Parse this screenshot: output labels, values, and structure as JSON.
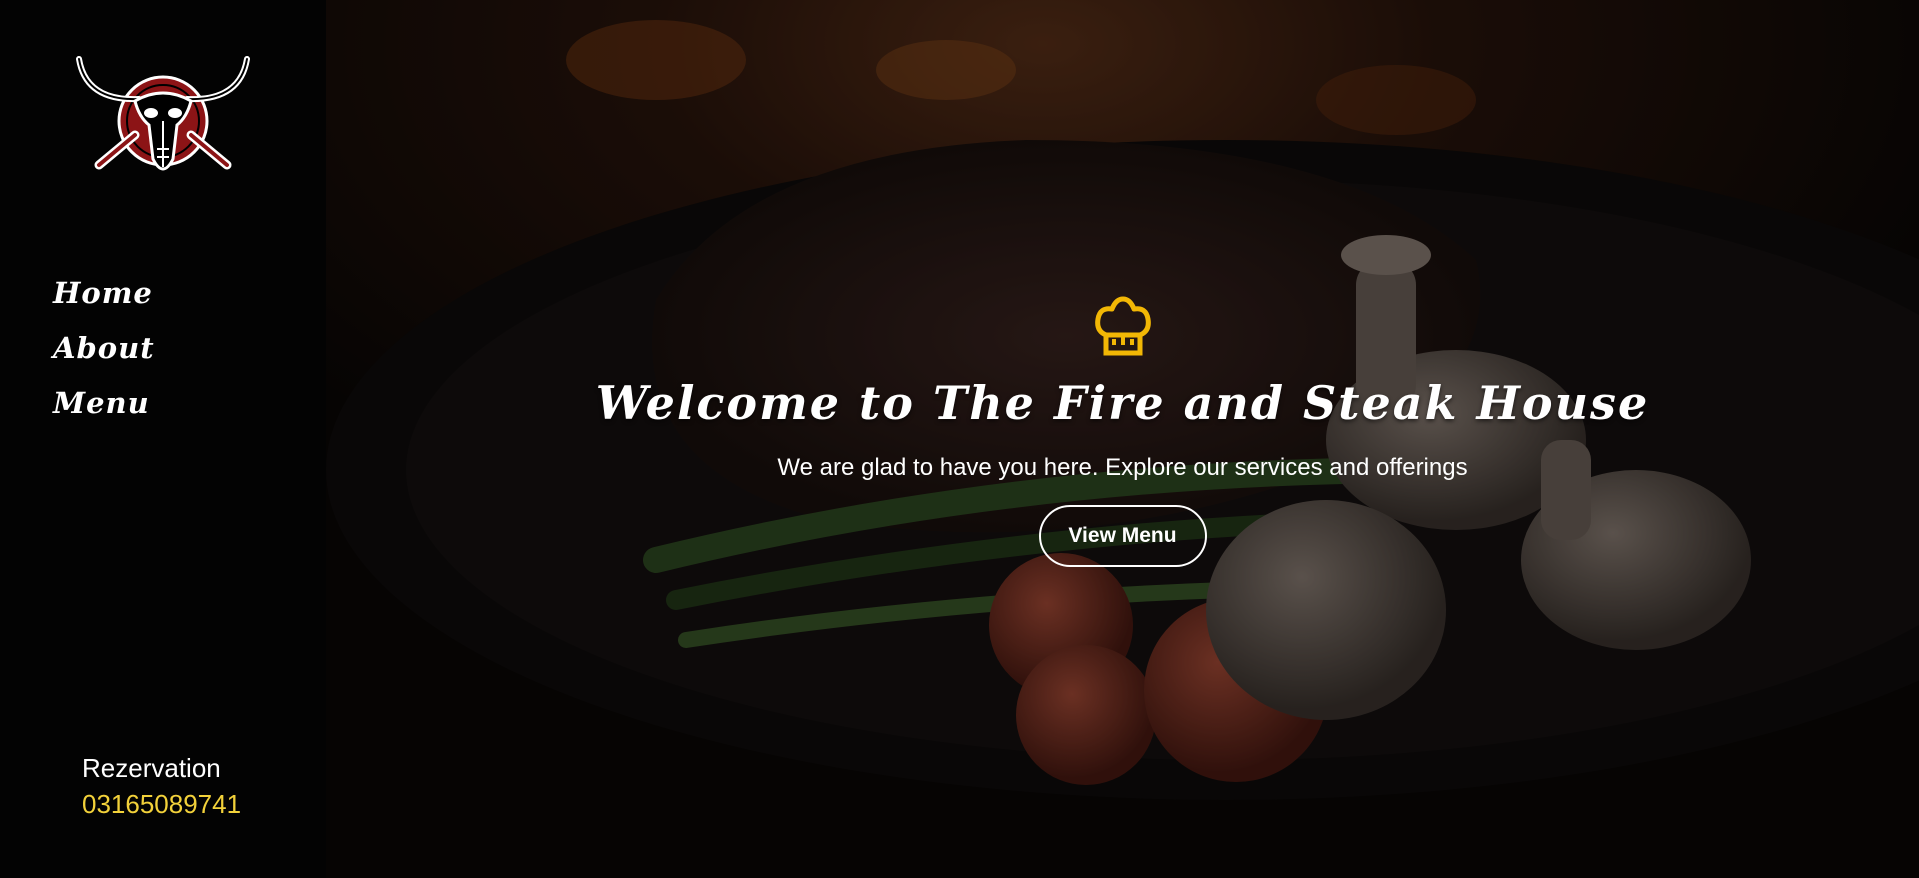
{
  "sidebar": {
    "logo_icon": "bull-skull-crossed-spatulas-logo",
    "nav": [
      {
        "label": "Home"
      },
      {
        "label": "About"
      },
      {
        "label": "Menu"
      }
    ],
    "reservation": {
      "label": "Rezervation",
      "phone": "03165089741"
    }
  },
  "hero": {
    "icon": "chef-hat-icon",
    "title": "Welcome to The Fire and Steak House",
    "subtitle": "We are glad to have you here. Explore our services and offerings",
    "cta_label": "View Menu"
  },
  "colors": {
    "accent": "#f2b705",
    "phone": "#f2d13a",
    "logo_red": "#8c1416",
    "sidebar_bg": "#030303"
  }
}
